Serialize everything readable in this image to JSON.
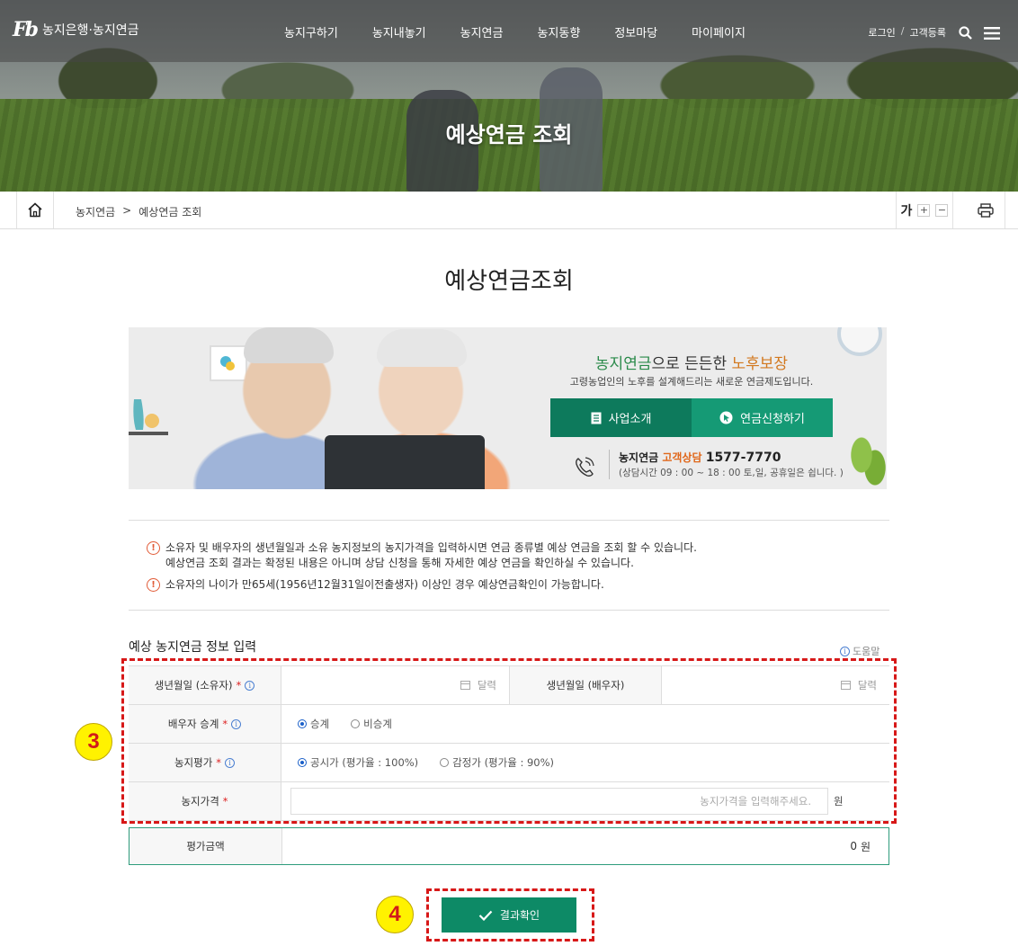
{
  "header": {
    "logo_mark": "Fb",
    "logo_text": "농지은행·농지연금",
    "nav": [
      "농지구하기",
      "농지내놓기",
      "농지연금",
      "농지동향",
      "정보마당",
      "마이페이지"
    ],
    "login": "로그인",
    "separator": "/",
    "register": "고객등록"
  },
  "hero_title": "예상연금 조회",
  "breadcrumb": {
    "level1": "농지연금",
    "sep": ">",
    "level2": "예상연금 조회"
  },
  "font_control": {
    "label": "가",
    "plus": "+",
    "minus": "−"
  },
  "page_title": "예상연금조회",
  "banner": {
    "head_green": "농지연금",
    "head_mid": "으로 든든한 ",
    "head_orange": "노후보장",
    "sub": "고령농업인의 노후를 설계해드리는 새로운 연금제도입니다.",
    "btn_intro": "사업소개",
    "btn_apply": "연금신청하기",
    "contact_label": "농지연금 ",
    "contact_orange": "고객상담",
    "contact_number": "1577-7770",
    "contact_hours": "(상담시간 09 : 00 ~ 18 : 00 토,일, 공휴일은 쉽니다. )"
  },
  "notices": {
    "n1_line1": "소유자 및 배우자의 생년월일과 소유 농지정보의 농지가격을 입력하시면 연금 종류별 예상 연금을 조회 할 수 있습니다.",
    "n1_line2": "예상연금 조회 결과는 확정된 내용은 아니며 상담 신청을 통해 자세한 예상 연금을 확인하실 수 있습니다.",
    "n2": "소유자의 나이가 만65세(1956년12월31일이전출생자) 이상인 경우 예상연금확인이 가능합니다.",
    "icon": "!"
  },
  "form": {
    "section_title": "예상 농지연금 정보 입력",
    "help": "도움말",
    "info_glyph": "i",
    "owner_birth_label": "생년월일 (소유자)",
    "spouse_birth_label": "생년월일 (배우자)",
    "calendar_label": "달력",
    "succession_label": "배우자 승계",
    "succession_options": [
      "승계",
      "비승계"
    ],
    "succession_selected": "승계",
    "valuation_label": "농지평가",
    "valuation_options": [
      "공시가 (평가율 : 100%)",
      "감정가 (평가율 : 90%)"
    ],
    "valuation_selected": "공시가 (평가율 : 100%)",
    "price_label": "농지가격",
    "price_placeholder": "농지가격을 입력해주세요.",
    "unit": "원",
    "required_mark": "*",
    "eval_label": "평가금액",
    "eval_value": "0",
    "eval_unit": "원"
  },
  "confirm_button": "결과확인",
  "annotations": {
    "badge3": "3",
    "badge4": "4"
  }
}
